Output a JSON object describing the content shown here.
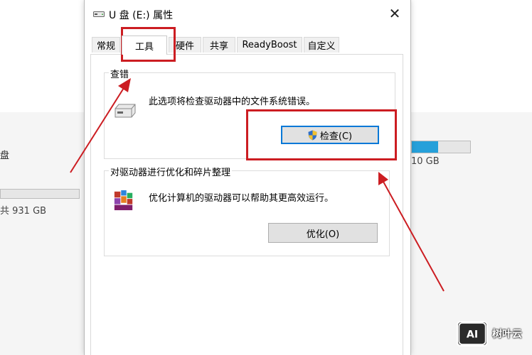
{
  "background": {
    "left_drive_label": "盘",
    "left_drive_size": "共 931 GB",
    "right_drive_size": "10 GB",
    "right_drive_usage_fraction": 0.45,
    "accent_color": "#26a0da"
  },
  "dialog": {
    "title": "U 盘 (E:) 属性",
    "close_symbol": "✕",
    "tabs": [
      {
        "label": "常规"
      },
      {
        "label": "工具"
      },
      {
        "label": "硬件"
      },
      {
        "label": "共享"
      },
      {
        "label": "ReadyBoost"
      },
      {
        "label": "自定义"
      }
    ],
    "active_tab": "工具",
    "error_checking": {
      "title": "查错",
      "description": "此选项将检查驱动器中的文件系统错误。",
      "button_label": "检查(C)",
      "icon": "drive-icon"
    },
    "optimize": {
      "title": "对驱动器进行优化和碎片整理",
      "description": "优化计算机的驱动器可以帮助其更高效运行。",
      "button_label": "优化(O)",
      "icon": "defrag-icon"
    }
  },
  "annotations": {
    "color": "#cc1d22"
  },
  "watermark": {
    "logo_text": "AI",
    "text": "树叶云"
  }
}
